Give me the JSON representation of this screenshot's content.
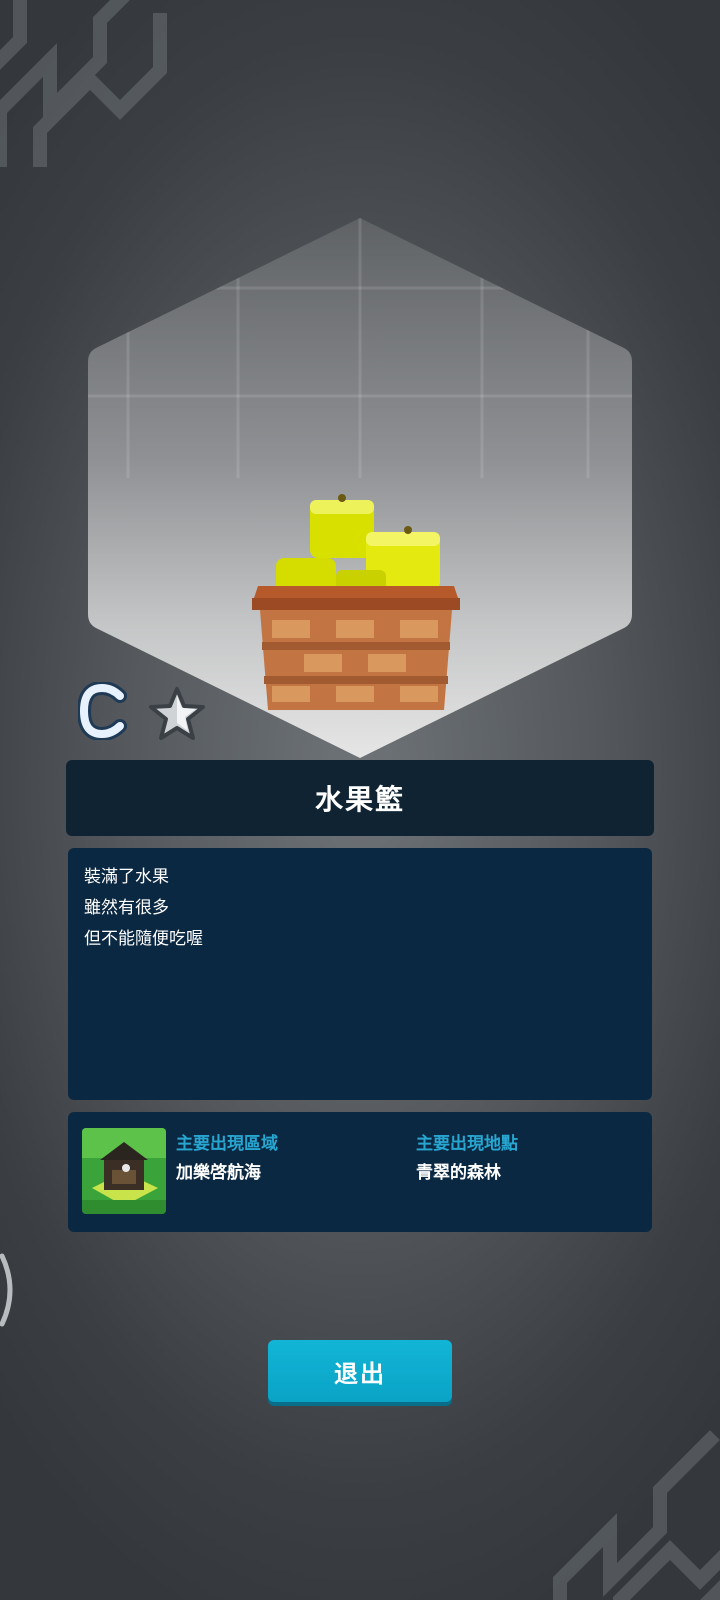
{
  "item": {
    "name": "水果籃",
    "rank": "C",
    "description_lines": [
      "裝滿了水果",
      "雖然有很多",
      "但不能隨便吃喔"
    ]
  },
  "location": {
    "region_label": "主要出現區域",
    "region_value": "加樂啓航海",
    "spot_label": "主要出現地點",
    "spot_value": "青翠的森林"
  },
  "actions": {
    "exit_label": "退出"
  },
  "colors": {
    "accent": "#27a6d1",
    "button": "#0aa3c6",
    "panel": "#0b2842",
    "title_bar": "#0f2333"
  },
  "icons": {
    "rank_star": "star-icon",
    "item_image": "fruit-basket-icon",
    "location_thumb": "island-thumbnail-icon"
  }
}
